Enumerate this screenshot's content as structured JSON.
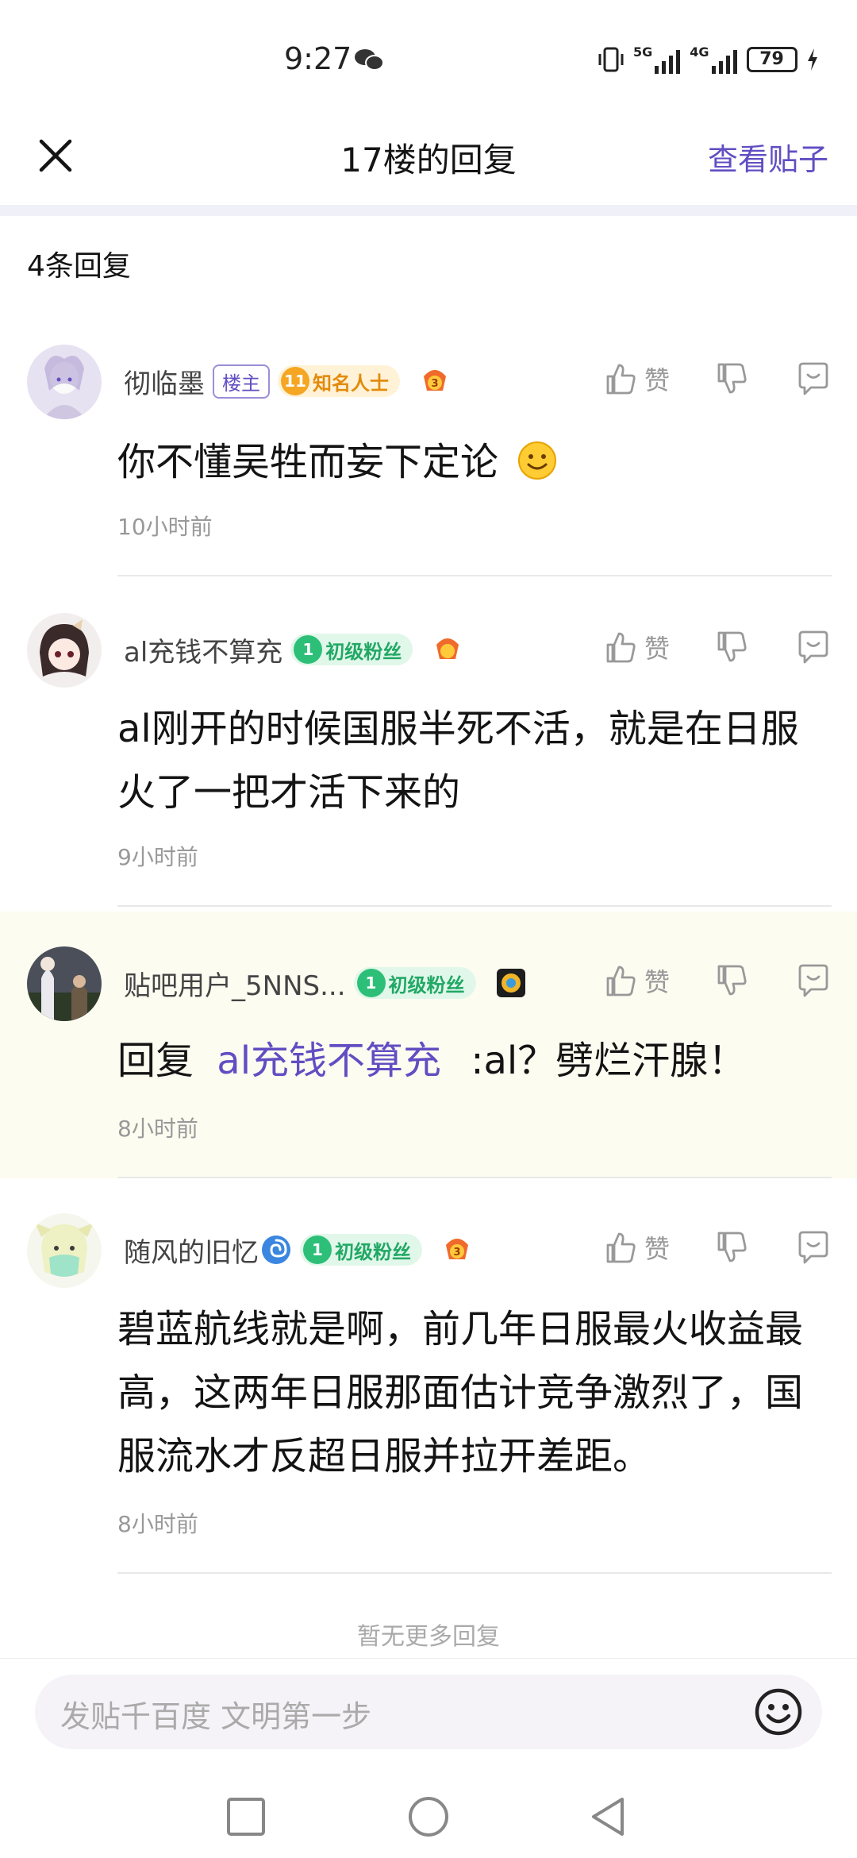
{
  "status": {
    "time": "9:27",
    "network_1": "5G",
    "network_2": "4G",
    "battery": "79"
  },
  "nav": {
    "title": "17楼的回复",
    "view_post": "查看贴子"
  },
  "reply_count": "4条回复",
  "like_label": "赞",
  "comments": [
    {
      "username": "彻临墨",
      "host_badge": "楼主",
      "level": "11",
      "level_title": "知名人士",
      "medal": "3",
      "content": "你不懂吴牲而妄下定论",
      "time": "10小时前"
    },
    {
      "username": "al充钱不算充",
      "level": "1",
      "level_title": "初级粉丝",
      "content": "al刚开的时候国服半死不活，就是在日服火了一把才活下来的",
      "time": "9小时前"
    },
    {
      "username": "贴吧用户_5NNS...",
      "level": "1",
      "level_title": "初级粉丝",
      "content_prefix": "回复",
      "mention": "al充钱不算充",
      "content_suffix": ":al？劈烂汗腺！",
      "time": "8小时前"
    },
    {
      "username": "随风的旧忆",
      "level": "1",
      "level_title": "初级粉丝",
      "medal": "3",
      "content": "碧蓝航线就是啊，前几年日服最火收益最高，这两年日服那面估计竞争激烈了，国服流水才反超日服并拉开差距。",
      "time": "8小时前"
    }
  ],
  "no_more": "暂无更多回复",
  "input": {
    "placeholder": "发贴千百度 文明第一步"
  },
  "colors": {
    "accent": "#614ec2",
    "highlight_bg": "#fdfcf1",
    "level_gold": "#f5a623",
    "level_green": "#2dbf78"
  }
}
